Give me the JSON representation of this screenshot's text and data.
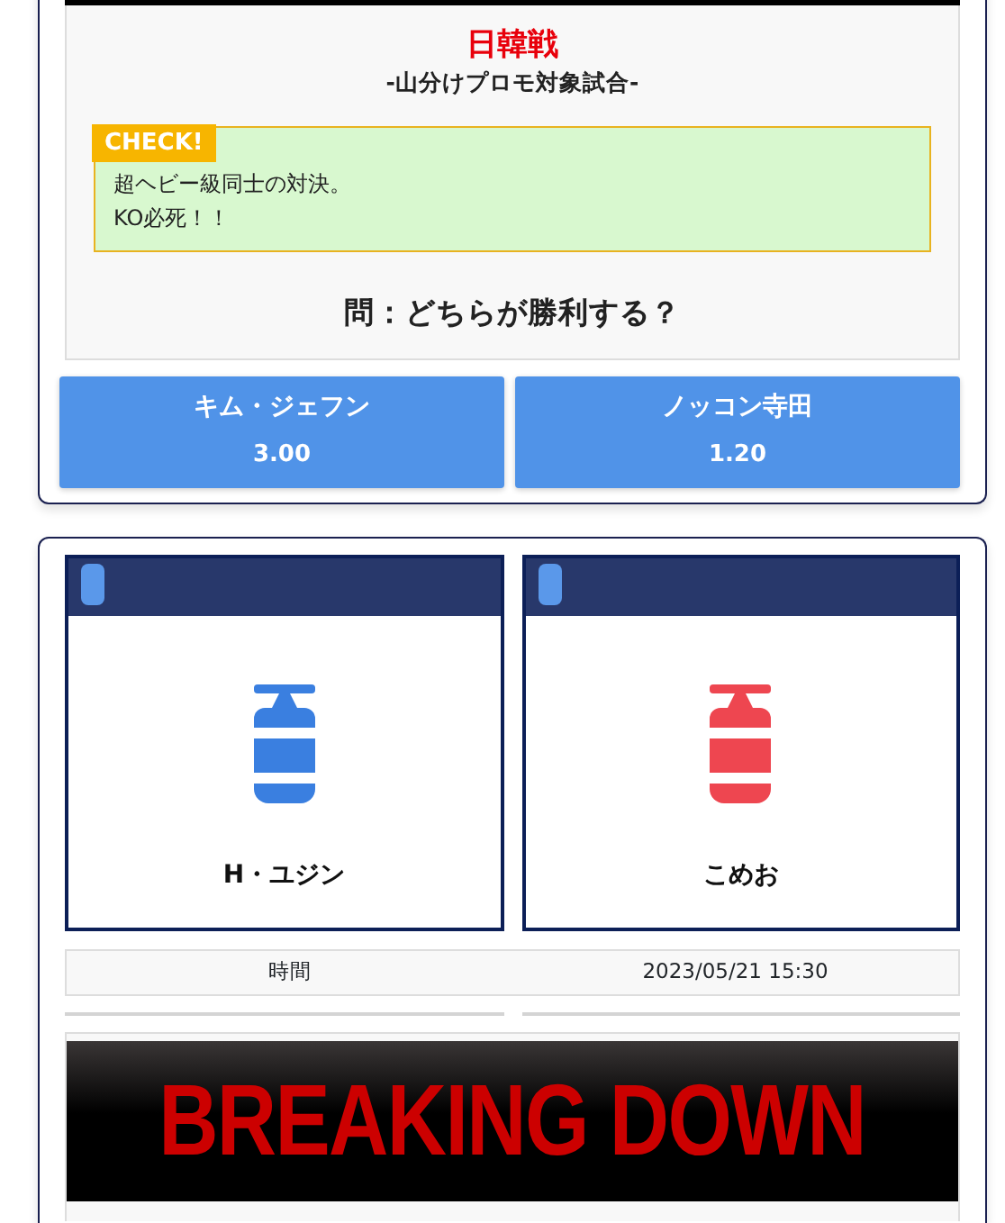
{
  "match": {
    "title": "日韓戦",
    "subtitle": "-山分けプロモ対象試合-",
    "check": {
      "badge": "CHECK!",
      "lines": [
        "超ヘビー級同士の対決。",
        "KO必死！！"
      ]
    },
    "question": "問：どちらが勝利する？",
    "options": [
      {
        "name": "キム・ジェフン",
        "odds": "3.00"
      },
      {
        "name": "ノッコン寺田",
        "odds": "1.20"
      }
    ]
  },
  "next_match": {
    "fighters": [
      {
        "name": "H・ユジン",
        "color": "#3a7fe0"
      },
      {
        "name": "こめお",
        "color": "#ee4650"
      }
    ],
    "info": {
      "label": "時間",
      "value": "2023/05/21 15:30"
    },
    "banner": {
      "title": "BREAKING DOWN"
    }
  }
}
